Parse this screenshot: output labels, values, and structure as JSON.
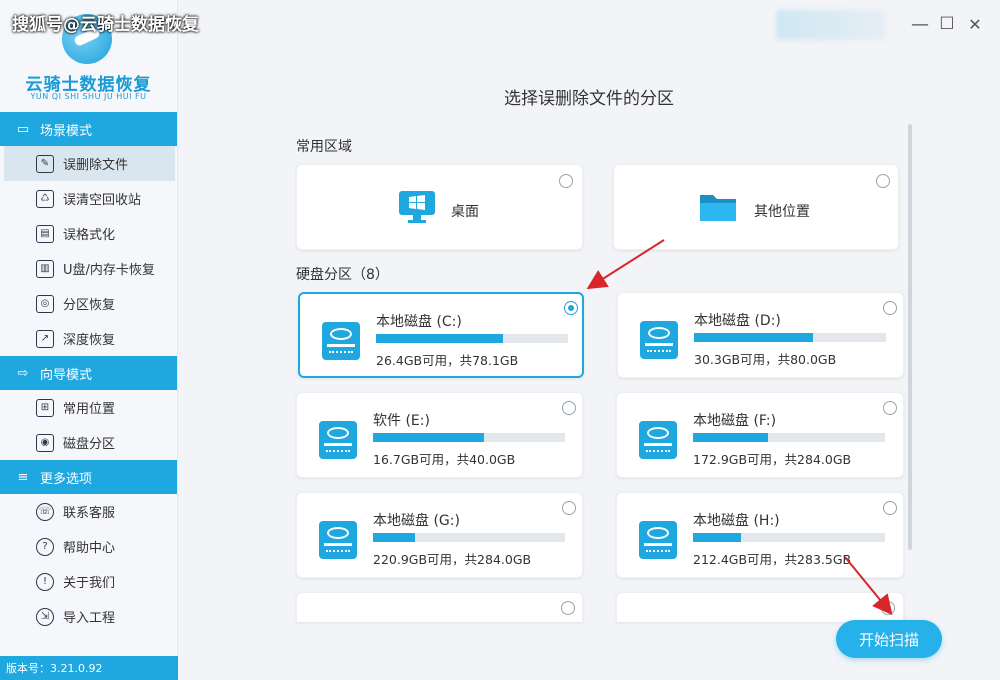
{
  "watermark": "搜狐号@云骑士数据恢复",
  "logo": {
    "title": "云骑士数据恢复",
    "subtitle": "YUN QI SHI SHU JU HUI FU"
  },
  "sidebar": {
    "sections": [
      {
        "title": "场景模式",
        "icon": "monitor-icon",
        "items": [
          {
            "label": "误删除文件",
            "icon": "file-delete-icon",
            "active": true
          },
          {
            "label": "误清空回收站",
            "icon": "recycle-bin-icon"
          },
          {
            "label": "误格式化",
            "icon": "format-disk-icon"
          },
          {
            "label": "U盘/内存卡恢复",
            "icon": "usb-card-icon"
          },
          {
            "label": "分区恢复",
            "icon": "partition-icon"
          },
          {
            "label": "深度恢复",
            "icon": "deep-recover-icon"
          }
        ]
      },
      {
        "title": "向导模式",
        "icon": "signpost-icon",
        "items": [
          {
            "label": "常用位置",
            "icon": "windows-location-icon"
          },
          {
            "label": "磁盘分区",
            "icon": "disk-partition-icon"
          }
        ]
      },
      {
        "title": "更多选项",
        "icon": "menu-icon",
        "items": [
          {
            "label": "联系客服",
            "icon": "phone-support-icon"
          },
          {
            "label": "帮助中心",
            "icon": "question-icon"
          },
          {
            "label": "关于我们",
            "icon": "info-icon"
          },
          {
            "label": "导入工程",
            "icon": "import-icon"
          }
        ]
      }
    ],
    "version": "版本号：3.21.0.92"
  },
  "window": {
    "minimize": "—",
    "maximize": "☐",
    "close": "✕"
  },
  "main": {
    "title": "选择误删除文件的分区",
    "common_label": "常用区域",
    "common": [
      {
        "label": "桌面",
        "icon": "desktop-icon"
      },
      {
        "label": "其他位置",
        "icon": "folder-icon"
      }
    ],
    "disks_label": "硬盘分区（8）",
    "disks": [
      {
        "name": "本地磁盘 (C:)",
        "info": "26.4GB可用，共78.1GB",
        "used_fraction": 0.66,
        "selected": true
      },
      {
        "name": "本地磁盘 (D:)",
        "info": "30.3GB可用，共80.0GB",
        "used_fraction": 0.62
      },
      {
        "name": "软件 (E:)",
        "info": "16.7GB可用，共40.0GB",
        "used_fraction": 0.58
      },
      {
        "name": "本地磁盘 (F:)",
        "info": "172.9GB可用，共284.0GB",
        "used_fraction": 0.39
      },
      {
        "name": "本地磁盘 (G:)",
        "info": "220.9GB可用，共284.0GB",
        "used_fraction": 0.22
      },
      {
        "name": "本地磁盘 (H:)",
        "info": "212.4GB可用，共283.5GB",
        "used_fraction": 0.25
      }
    ],
    "start_button": "开始扫描"
  },
  "colors": {
    "accent": "#1fa7e0",
    "arrow": "#d9262b"
  }
}
